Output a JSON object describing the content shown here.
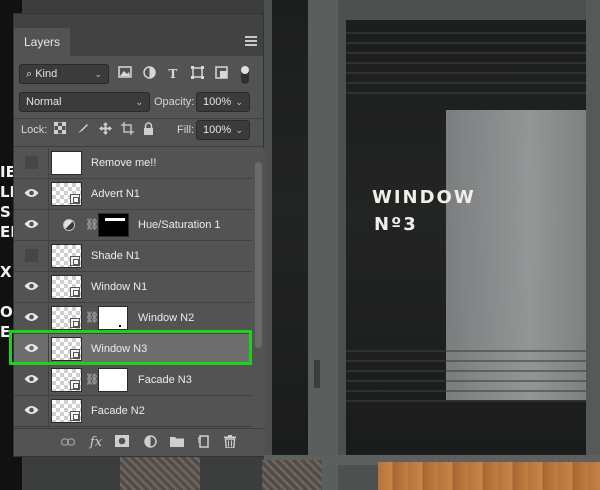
{
  "background": {
    "window_text_line1": "WINDOW",
    "window_text_line2": "Nº3",
    "left_letters": [
      "IES",
      "LE",
      "S",
      "EM",
      "X",
      "ON",
      "E"
    ]
  },
  "panel": {
    "close_glyph": "×",
    "collapse_glyph": "‹‹",
    "tab_label": "Layers",
    "filter": {
      "kind_label": "⌕ Kind",
      "icons": [
        "image-filter-icon",
        "adjustment-filter-icon",
        "type-filter-icon",
        "shape-filter-icon",
        "smart-object-filter-icon"
      ],
      "type_glyph": "T"
    },
    "blend_mode": "Normal",
    "opacity_label": "Opacity:",
    "opacity_value": "100%",
    "lock_label": "Lock:",
    "fill_label": "Fill:",
    "fill_value": "100%",
    "layers": [
      {
        "name": "Remove me!!",
        "visible": false,
        "thumb": "white"
      },
      {
        "name": "Advert N1",
        "visible": true,
        "thumb": "smart"
      },
      {
        "name": "Hue/Saturation 1",
        "visible": true,
        "thumb": "adjustment"
      },
      {
        "name": "Shade N1",
        "visible": false,
        "thumb": "smart"
      },
      {
        "name": "Window N1",
        "visible": true,
        "thumb": "smart"
      },
      {
        "name": "Window N2",
        "visible": true,
        "thumb": "smart-mask"
      },
      {
        "name": "Window N3",
        "visible": true,
        "thumb": "smart",
        "selected": true
      },
      {
        "name": "Facade N3",
        "visible": true,
        "thumb": "smart-mask"
      },
      {
        "name": "Facade N2",
        "visible": true,
        "thumb": "smart"
      }
    ],
    "bottom_icons": [
      "link-layers-icon",
      "fx-icon",
      "add-mask-icon",
      "new-adjustment-icon",
      "new-group-icon",
      "new-layer-icon",
      "delete-icon"
    ],
    "fx_label": "fx"
  },
  "colors": {
    "highlight": "#19d21b",
    "panel_bg": "#535353"
  }
}
